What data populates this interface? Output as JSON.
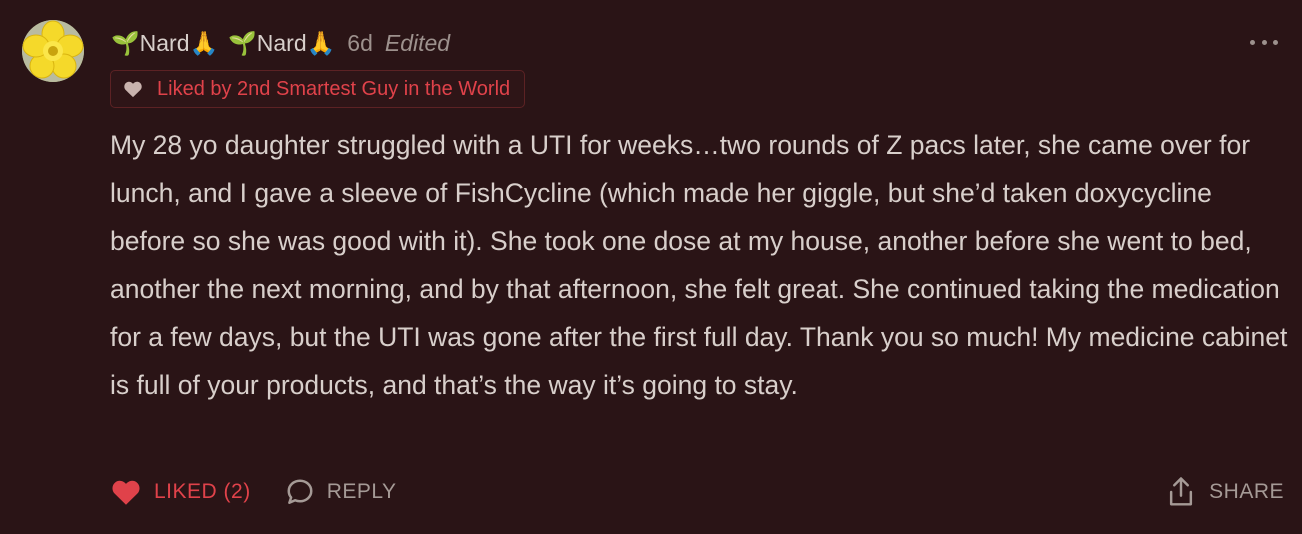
{
  "comment": {
    "author_name": "🌱Nard🙏",
    "author_handle": "🌱Nard🙏",
    "timestamp": "6d",
    "edited_label": "Edited",
    "avatar_icon": "yellow-flower-avatar",
    "liked_by": "Liked by 2nd Smartest Guy in the World",
    "body": "My 28 yo daughter struggled with a UTI for weeks…two rounds of Z pacs later, she came over for lunch, and I gave a sleeve of FishCycline (which made her giggle, but she’d taken doxycycline before so she was good with it). She took one dose at my house, another before she went to bed, another the next morning, and by that afternoon, she felt great. She continued taking the medication for a few days, but the UTI was gone after the first full day. Thank you so much! My medicine cabinet is full of your products, and that’s the way it’s going to stay.",
    "actions": {
      "like_label": "LIKED (2)",
      "reply_label": "REPLY",
      "share_label": "SHARE"
    }
  },
  "colors": {
    "background": "#2a1416",
    "accent_red": "#e0424a",
    "text": "#d8cfcb",
    "muted": "#9d918d"
  }
}
